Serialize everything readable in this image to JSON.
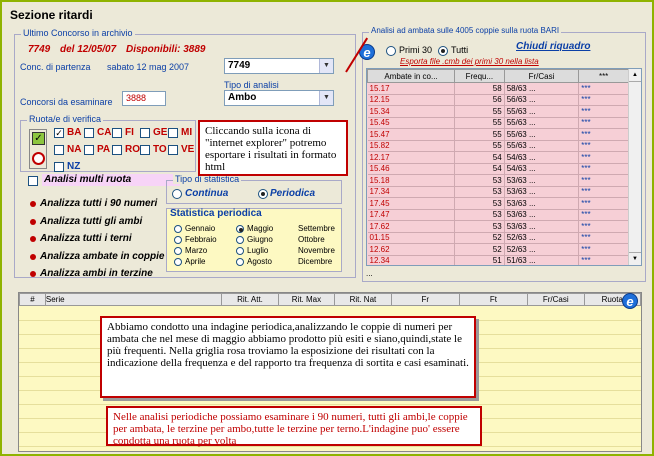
{
  "window": {
    "title": "Sezione ritardi"
  },
  "ultimo": {
    "group_label": "Ultimo Concorso in archivio",
    "concorso": "7749",
    "del_label": "del 12/05/07",
    "disponibili": "Disponibili: 3889",
    "conc_partenza_label": "Conc. di partenza",
    "conc_partenza_date": "sabato 12 mag 2007",
    "conc_partenza_value": "7749",
    "tipo_analisi_label": "Tipo di analisi",
    "tipo_analisi_value": "Ambo",
    "concorsi_esaminare_label": "Concorsi da esaminare",
    "concorsi_esaminare_value": "3888"
  },
  "ruote": {
    "group_label": "Ruota/e di verifica",
    "items": [
      {
        "label": "BA",
        "checked": true
      },
      {
        "label": "CA",
        "checked": false
      },
      {
        "label": "FI",
        "checked": false
      },
      {
        "label": "GE",
        "checked": false
      },
      {
        "label": "MI",
        "checked": false
      },
      {
        "label": "NA",
        "checked": false
      },
      {
        "label": "PA",
        "checked": false
      },
      {
        "label": "RO",
        "checked": false
      },
      {
        "label": "TO",
        "checked": false
      },
      {
        "label": "VE",
        "checked": false
      },
      {
        "label": "NZ",
        "checked": false
      }
    ],
    "multi_ruota_label": "Analisi multi ruota"
  },
  "analisi_links": [
    "Analizza tutti i 90 numeri",
    "Analizza tutti gli ambi",
    "Analizza tutti i terni",
    "Analizza ambate in coppie",
    "Analizza ambi in terzine"
  ],
  "statistica": {
    "tipo_label": "Tipo di statistica",
    "continua": "Continua",
    "periodica": "Periodica",
    "periodica_group": "Statistica periodica",
    "mesi": [
      {
        "name": "Gennaio",
        "on": false
      },
      {
        "name": "Maggio",
        "on": true
      },
      {
        "name": "Settembre",
        "on": false
      },
      {
        "name": "Febbraio",
        "on": false
      },
      {
        "name": "Giugno",
        "on": false
      },
      {
        "name": "Ottobre",
        "on": false
      },
      {
        "name": "Marzo",
        "on": false
      },
      {
        "name": "Luglio",
        "on": false
      },
      {
        "name": "Novembre",
        "on": false
      },
      {
        "name": "Aprile",
        "on": false
      },
      {
        "name": "Agosto",
        "on": false
      },
      {
        "name": "Dicembre",
        "on": false
      }
    ]
  },
  "results": {
    "group_label": "Analisi ad ambata sulle 4005 coppie sulla ruota BARI",
    "primi30": "Primi 30",
    "tutti": "Tutti",
    "chiudi": "Chiudi riquadro",
    "esporta": "Esporta file .cmb dei primi 30 nella lista",
    "columns": [
      "Ambate in co...",
      "Frequ...",
      "Fr/Casi",
      "***"
    ],
    "rows": [
      [
        "15.17",
        "58",
        "58/63 ...",
        "***"
      ],
      [
        "12.15",
        "56",
        "56/63 ...",
        "***"
      ],
      [
        "15.34",
        "55",
        "55/63 ...",
        "***"
      ],
      [
        "15.45",
        "55",
        "55/63 ...",
        "***"
      ],
      [
        "15.47",
        "55",
        "55/63 ...",
        "***"
      ],
      [
        "15.82",
        "55",
        "55/63 ...",
        "***"
      ],
      [
        "12.17",
        "54",
        "54/63 ...",
        "***"
      ],
      [
        "15.46",
        "54",
        "54/63 ...",
        "***"
      ],
      [
        "15.18",
        "53",
        "53/63 ...",
        "***"
      ],
      [
        "17.34",
        "53",
        "53/63 ...",
        "***"
      ],
      [
        "17.45",
        "53",
        "53/63 ...",
        "***"
      ],
      [
        "17.47",
        "53",
        "53/63 ...",
        "***"
      ],
      [
        "17.62",
        "53",
        "53/63 ...",
        "***"
      ],
      [
        "01.15",
        "52",
        "52/63 ...",
        "***"
      ],
      [
        "12.62",
        "52",
        "52/63 ...",
        "***"
      ],
      [
        "12.34",
        "51",
        "51/63 ...",
        "***"
      ]
    ],
    "more": "..."
  },
  "bottom_table": {
    "columns": [
      "#",
      "Serie",
      "Rit. Att.",
      "Rit. Max",
      "Rit. Nat",
      "Fr",
      "Ft",
      "Fr/Casi",
      "Ruota"
    ]
  },
  "notes": {
    "ie": "Cliccando sulla icona di \"internet explorer\" potremo esportare i risultati in formato html",
    "periodica": "Abbiamo condotto una indagine periodica,analizzando le coppie di numeri per ambata che nel mese di maggio abbiamo prodotto più esiti e siano,quindi,state le più frequenti. Nella griglia rosa troviamo la esposizione dei risultati con la indicazione della frequenza e del rapporto tra frequenza di sortita e casi esaminati.",
    "analisi": "Nelle analisi periodiche possiamo esaminare i 90 numeri, tutti gli ambi,le coppie per ambata, le terzine per ambo,tutte le terzine per terno.L'indagine puo' essere condotta una ruota per volta"
  },
  "colors": {
    "accent": "#c00000",
    "link": "#0b3fa6",
    "grid_pink": "#f6cfd6",
    "frame": "#8fb300"
  }
}
